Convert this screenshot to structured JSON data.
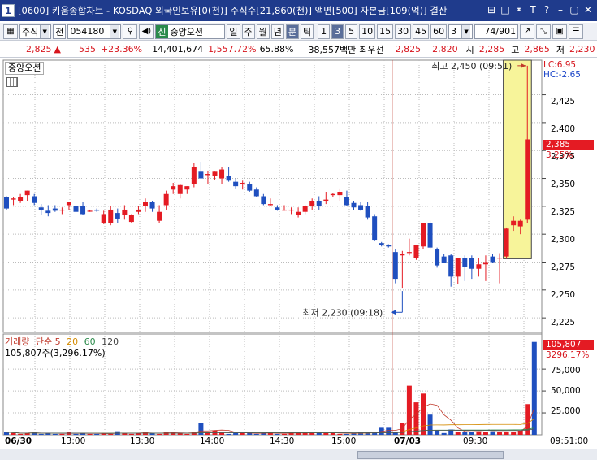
{
  "title": {
    "window_number": "1",
    "text": "[0600] 키움종합차트 - KOSDAQ 외국인보유[0(천)] 주식수[21,860(천)] 액면[500] 자본금[109(억)] 결산"
  },
  "toolbar": {
    "market": "주식",
    "period_type": "전",
    "code": "054180",
    "badge": "신",
    "stock_name": "중앙오션",
    "periods": [
      "일",
      "주",
      "월",
      "년",
      "분",
      "틱"
    ],
    "intervals": [
      "1",
      "3",
      "5",
      "10",
      "15",
      "30",
      "45",
      "60"
    ],
    "custom_interval": "3",
    "page_count": "74/901"
  },
  "info": {
    "price": "2,825",
    "arrow": "▲",
    "change": "535",
    "change_pct": "+23.36%",
    "volume": "14,401,674",
    "volume_pct": "1,557.72%",
    "ratio": "65.88%",
    "amount": "38,557백만",
    "best_label": "최우선",
    "ask": "2,825",
    "bid": "2,820",
    "open_label": "시",
    "open": "2,285",
    "high_label": "고",
    "high": "2,865",
    "low_label": "저",
    "low": "2,230"
  },
  "chart_label": "중앙오션",
  "price_axis": {
    "lc": "LC:6.95",
    "hc": "HC:-2.65",
    "ticks": [
      "2,425",
      "2,400",
      "2,375",
      "2,350",
      "2,325",
      "2,300",
      "2,275",
      "2,250",
      "2,225"
    ],
    "current": "2,385",
    "current_pct": "3.25%"
  },
  "annotations": {
    "high": "최고 2,450 (09:51)",
    "low": "최저 2,230 (09:18)"
  },
  "volume_panel": {
    "legend": {
      "name": "거래량",
      "ma_label": "단순",
      "ma1": "5",
      "ma2": "20",
      "ma3": "60",
      "ma4": "120"
    },
    "value_line": "105,807주(3,296.17%)",
    "ticks": [
      "75,000",
      "50,000",
      "25,000"
    ],
    "current": "105,807",
    "current_pct": "3296.17%"
  },
  "time_axis": {
    "labels": [
      "06/30",
      "13:00",
      "13:30",
      "14:00",
      "14:30",
      "15:00",
      "07/03",
      "09:30",
      "09:51:00"
    ]
  },
  "colors": {
    "up": "#e41b23",
    "down": "#1f4fbf",
    "title_bg": "#1f3b8c",
    "highlight": "#f7f49a"
  },
  "chart_data": {
    "type": "candlestick",
    "price_ylim": [
      2212,
      2456
    ],
    "candles": [
      {
        "o": 2333,
        "h": 2334,
        "l": 2322,
        "c": 2323
      },
      {
        "o": 2331,
        "h": 2333,
        "l": 2326,
        "c": 2332
      },
      {
        "o": 2330,
        "h": 2336,
        "l": 2328,
        "c": 2333
      },
      {
        "o": 2335,
        "h": 2339,
        "l": 2330,
        "c": 2339
      },
      {
        "o": 2334,
        "h": 2336,
        "l": 2326,
        "c": 2328
      },
      {
        "o": 2324,
        "h": 2327,
        "l": 2317,
        "c": 2322
      },
      {
        "o": 2321,
        "h": 2326,
        "l": 2316,
        "c": 2319
      },
      {
        "o": 2323,
        "h": 2326,
        "l": 2320,
        "c": 2321
      },
      {
        "o": 2322,
        "h": 2324,
        "l": 2318,
        "c": 2322
      },
      {
        "o": 2326,
        "h": 2329,
        "l": 2322,
        "c": 2329
      },
      {
        "o": 2325,
        "h": 2327,
        "l": 2320,
        "c": 2320
      },
      {
        "o": 2325,
        "h": 2329,
        "l": 2317,
        "c": 2318
      },
      {
        "o": 2321,
        "h": 2322,
        "l": 2320,
        "c": 2321
      },
      {
        "o": 2322,
        "h": 2323,
        "l": 2320,
        "c": 2321
      },
      {
        "o": 2310,
        "h": 2321,
        "l": 2309,
        "c": 2318
      },
      {
        "o": 2310,
        "h": 2325,
        "l": 2308,
        "c": 2322
      },
      {
        "o": 2319,
        "h": 2323,
        "l": 2310,
        "c": 2314
      },
      {
        "o": 2317,
        "h": 2326,
        "l": 2313,
        "c": 2322
      },
      {
        "o": 2311,
        "h": 2318,
        "l": 2310,
        "c": 2317
      },
      {
        "o": 2320,
        "h": 2325,
        "l": 2318,
        "c": 2322
      },
      {
        "o": 2325,
        "h": 2332,
        "l": 2320,
        "c": 2329
      },
      {
        "o": 2329,
        "h": 2330,
        "l": 2320,
        "c": 2323
      },
      {
        "o": 2312,
        "h": 2326,
        "l": 2310,
        "c": 2320
      },
      {
        "o": 2326,
        "h": 2339,
        "l": 2322,
        "c": 2336
      },
      {
        "o": 2340,
        "h": 2346,
        "l": 2336,
        "c": 2343
      },
      {
        "o": 2336,
        "h": 2345,
        "l": 2332,
        "c": 2344
      },
      {
        "o": 2340,
        "h": 2343,
        "l": 2336,
        "c": 2343
      },
      {
        "o": 2345,
        "h": 2364,
        "l": 2342,
        "c": 2360
      },
      {
        "o": 2356,
        "h": 2365,
        "l": 2350,
        "c": 2350
      },
      {
        "o": 2353,
        "h": 2357,
        "l": 2345,
        "c": 2354
      },
      {
        "o": 2352,
        "h": 2356,
        "l": 2349,
        "c": 2356
      },
      {
        "o": 2350,
        "h": 2360,
        "l": 2345,
        "c": 2358
      },
      {
        "o": 2352,
        "h": 2360,
        "l": 2347,
        "c": 2348
      },
      {
        "o": 2347,
        "h": 2350,
        "l": 2341,
        "c": 2343
      },
      {
        "o": 2345,
        "h": 2348,
        "l": 2340,
        "c": 2346
      },
      {
        "o": 2345,
        "h": 2347,
        "l": 2338,
        "c": 2339
      },
      {
        "o": 2340,
        "h": 2342,
        "l": 2333,
        "c": 2334
      },
      {
        "o": 2334,
        "h": 2336,
        "l": 2326,
        "c": 2327
      },
      {
        "o": 2326,
        "h": 2332,
        "l": 2325,
        "c": 2327
      },
      {
        "o": 2324,
        "h": 2326,
        "l": 2321,
        "c": 2322
      },
      {
        "o": 2322,
        "h": 2326,
        "l": 2321,
        "c": 2322
      },
      {
        "o": 2322,
        "h": 2324,
        "l": 2318,
        "c": 2322
      },
      {
        "o": 2317,
        "h": 2324,
        "l": 2315,
        "c": 2320
      },
      {
        "o": 2320,
        "h": 2326,
        "l": 2318,
        "c": 2325
      },
      {
        "o": 2325,
        "h": 2332,
        "l": 2322,
        "c": 2330
      },
      {
        "o": 2330,
        "h": 2334,
        "l": 2322,
        "c": 2325
      },
      {
        "o": 2330,
        "h": 2338,
        "l": 2327,
        "c": 2331
      },
      {
        "o": 2335,
        "h": 2337,
        "l": 2333,
        "c": 2336
      },
      {
        "o": 2335,
        "h": 2341,
        "l": 2330,
        "c": 2338
      },
      {
        "o": 2333,
        "h": 2339,
        "l": 2325,
        "c": 2326
      },
      {
        "o": 2328,
        "h": 2330,
        "l": 2322,
        "c": 2324
      },
      {
        "o": 2326,
        "h": 2329,
        "l": 2321,
        "c": 2322
      },
      {
        "o": 2325,
        "h": 2329,
        "l": 2313,
        "c": 2315
      },
      {
        "o": 2316,
        "h": 2318,
        "l": 2294,
        "c": 2295
      },
      {
        "o": 2292,
        "h": 2293,
        "l": 2289,
        "c": 2290
      },
      {
        "o": 2290,
        "h": 2291,
        "l": 2288,
        "c": 2289
      },
      {
        "o": 2284,
        "h": 2287,
        "l": 2256,
        "c": 2260
      },
      {
        "o": 2281,
        "h": 2285,
        "l": 2252,
        "c": 2282
      },
      {
        "o": 2284,
        "h": 2296,
        "l": 2281,
        "c": 2284
      },
      {
        "o": 2279,
        "h": 2290,
        "l": 2277,
        "c": 2290
      },
      {
        "o": 2289,
        "h": 2310,
        "l": 2287,
        "c": 2310
      },
      {
        "o": 2310,
        "h": 2312,
        "l": 2287,
        "c": 2288
      },
      {
        "o": 2287,
        "h": 2288,
        "l": 2270,
        "c": 2272
      },
      {
        "o": 2280,
        "h": 2282,
        "l": 2275,
        "c": 2274
      },
      {
        "o": 2281,
        "h": 2282,
        "l": 2253,
        "c": 2262
      },
      {
        "o": 2262,
        "h": 2279,
        "l": 2255,
        "c": 2279
      },
      {
        "o": 2279,
        "h": 2281,
        "l": 2258,
        "c": 2271
      },
      {
        "o": 2279,
        "h": 2281,
        "l": 2260,
        "c": 2269
      },
      {
        "o": 2269,
        "h": 2279,
        "l": 2262,
        "c": 2273
      },
      {
        "o": 2273,
        "h": 2281,
        "l": 2258,
        "c": 2275
      },
      {
        "o": 2280,
        "h": 2282,
        "l": 2274,
        "c": 2275
      },
      {
        "o": 2279,
        "h": 2283,
        "l": 2256,
        "c": 2279
      },
      {
        "o": 2280,
        "h": 2306,
        "l": 2278,
        "c": 2305
      },
      {
        "o": 2308,
        "h": 2316,
        "l": 2303,
        "c": 2312
      },
      {
        "o": 2307,
        "h": 2313,
        "l": 2300,
        "c": 2312
      },
      {
        "o": 2313,
        "h": 2451,
        "l": 2310,
        "c": 2385
      }
    ],
    "volumes": [
      3,
      2,
      1,
      2,
      3,
      1,
      2,
      1,
      1,
      3,
      1,
      2,
      1,
      1,
      2,
      1,
      4,
      2,
      1,
      2,
      3,
      2,
      1,
      3,
      3,
      2,
      1,
      3,
      13,
      3,
      5,
      3,
      1,
      2,
      2,
      2,
      1,
      2,
      3,
      1,
      1,
      2,
      3,
      3,
      2,
      3,
      2,
      2,
      1,
      1,
      2,
      3,
      3,
      3,
      8,
      8,
      3,
      13,
      56,
      37,
      47,
      23,
      5,
      2,
      6,
      3,
      3,
      3,
      4,
      3,
      4,
      3,
      3,
      3,
      5,
      35,
      106
    ],
    "volume_ylim": [
      0,
      115
    ]
  }
}
